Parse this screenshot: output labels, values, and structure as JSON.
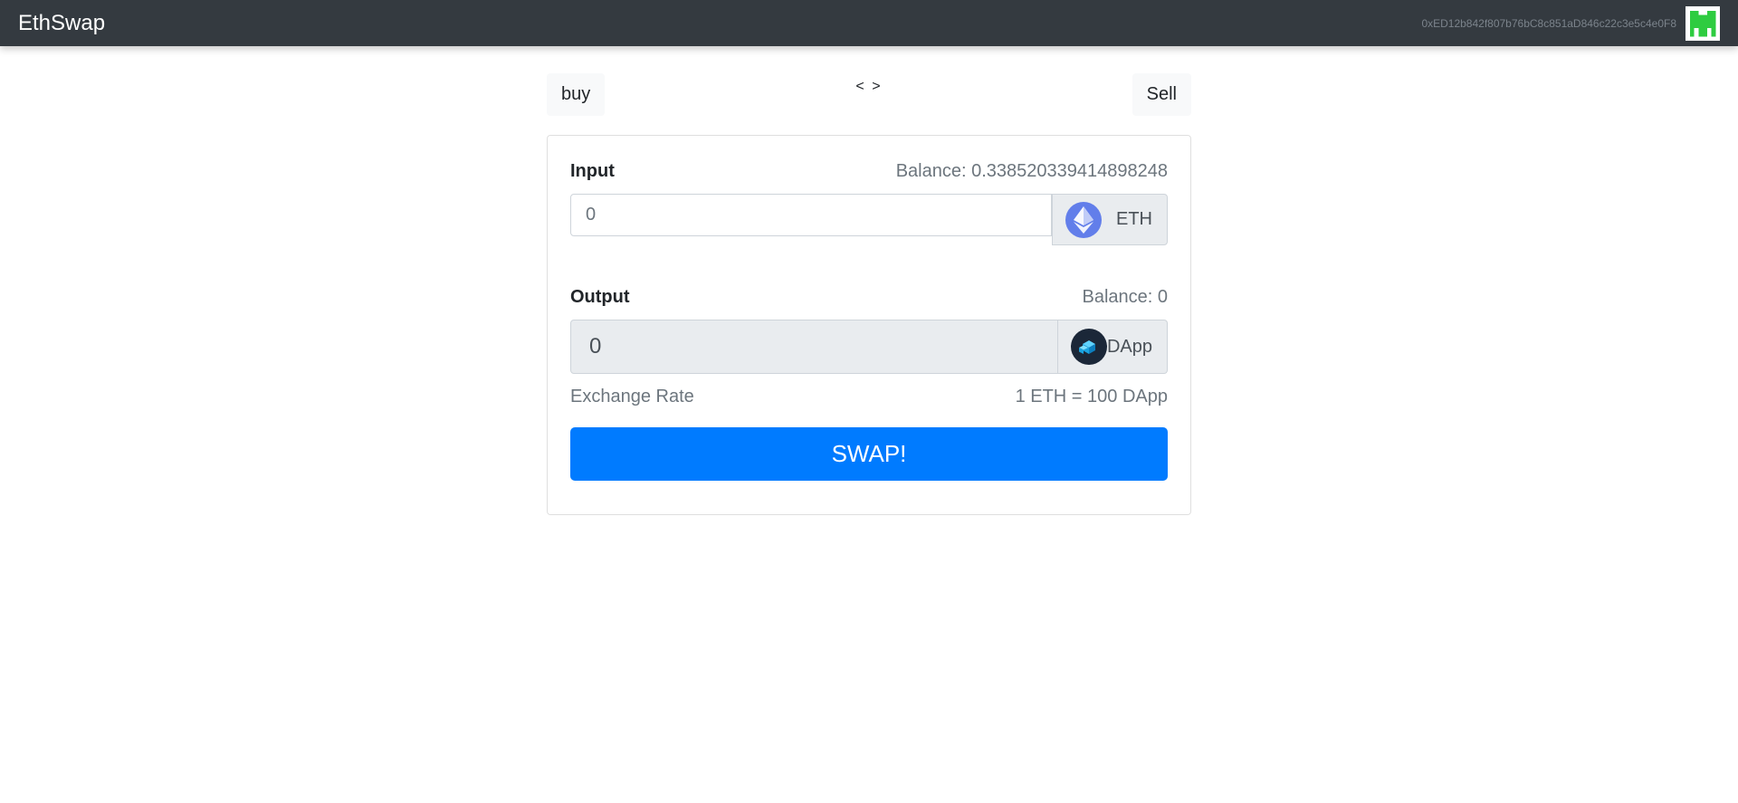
{
  "navbar": {
    "brand": "EthSwap",
    "account": "0xED12b842f807b76bC8c851aD846c22c3e5c4e0F8"
  },
  "mode": {
    "buy_label": "buy",
    "toggle_label": "< >",
    "sell_label": "Sell"
  },
  "form": {
    "input": {
      "label": "Input",
      "balance": "Balance: 0.338520339414898248",
      "placeholder": "0",
      "token": "ETH"
    },
    "output": {
      "label": "Output",
      "balance": "Balance: 0",
      "value": "0",
      "token": "DApp"
    },
    "exchange_rate": {
      "label": "Exchange Rate",
      "value": "1 ETH = 100 DApp"
    },
    "swap_label": "SWAP!"
  },
  "colors": {
    "navbar": "#343a40",
    "primary": "#007bff",
    "eth": "#627eea",
    "identicon": "#2ecc40"
  },
  "icons": {
    "input_token": "ethereum-icon",
    "output_token": "dapp-token-icon",
    "account": "identicon-avatar"
  }
}
